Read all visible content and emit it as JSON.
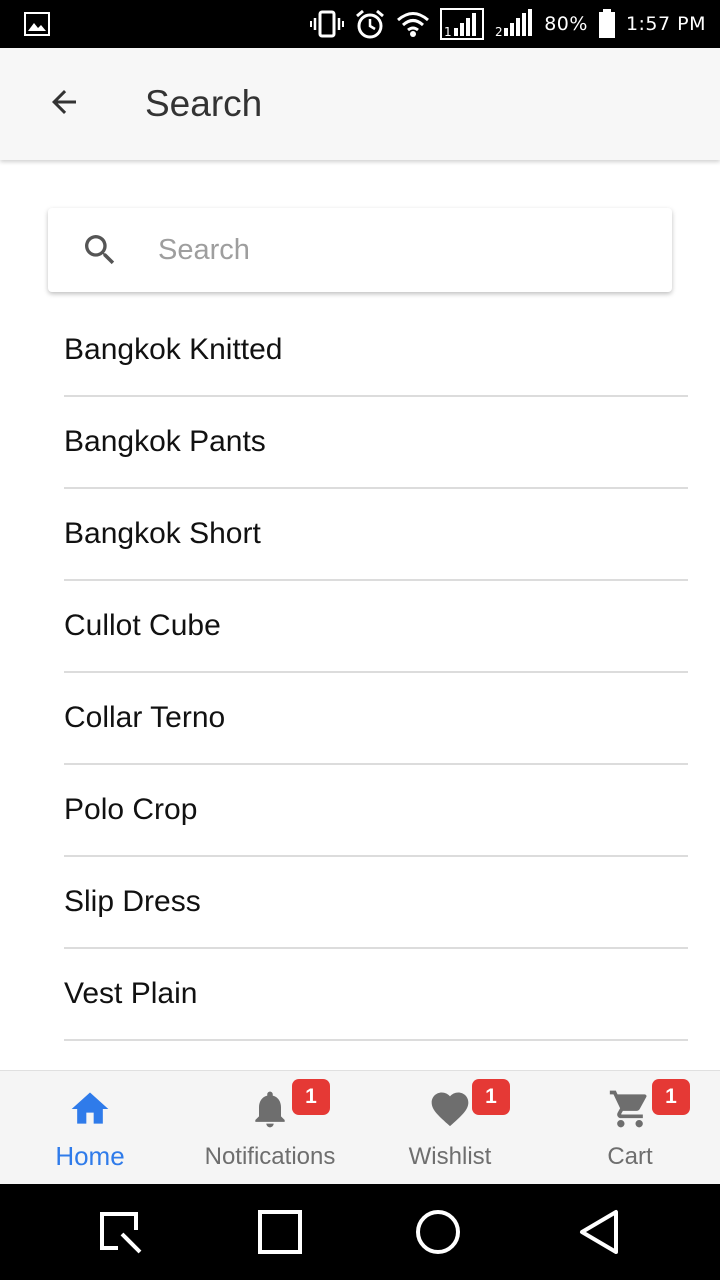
{
  "status_bar": {
    "battery": "80%",
    "time": "1:57 PM",
    "icons": [
      "gallery-icon",
      "vibrate-icon",
      "alarm-icon",
      "wifi-icon",
      "signal-sim1-icon",
      "signal-sim2-icon",
      "battery-icon"
    ]
  },
  "app_bar": {
    "title": "Search",
    "back_icon": "arrow-back-icon"
  },
  "search": {
    "placeholder": "Search",
    "value": "",
    "icon": "search-icon"
  },
  "results": [
    "Bangkok Knitted",
    "Bangkok Pants",
    "Bangkok Short",
    "Cullot Cube",
    "Collar Terno",
    "Polo Crop",
    "Slip Dress",
    "Vest Plain"
  ],
  "bottom_nav": {
    "items": [
      {
        "label": "Home",
        "icon": "home-icon",
        "active": true,
        "badge": ""
      },
      {
        "label": "Notifications",
        "icon": "bell-icon",
        "active": false,
        "badge": "1"
      },
      {
        "label": "Wishlist",
        "icon": "heart-icon",
        "active": false,
        "badge": "1"
      },
      {
        "label": "Cart",
        "icon": "cart-icon",
        "active": false,
        "badge": "1"
      }
    ]
  },
  "colors": {
    "accent": "#2f7bea",
    "badge": "#e53935",
    "inactive_icon": "#6e6e6e",
    "app_bar_bg": "#f7f7f7"
  }
}
